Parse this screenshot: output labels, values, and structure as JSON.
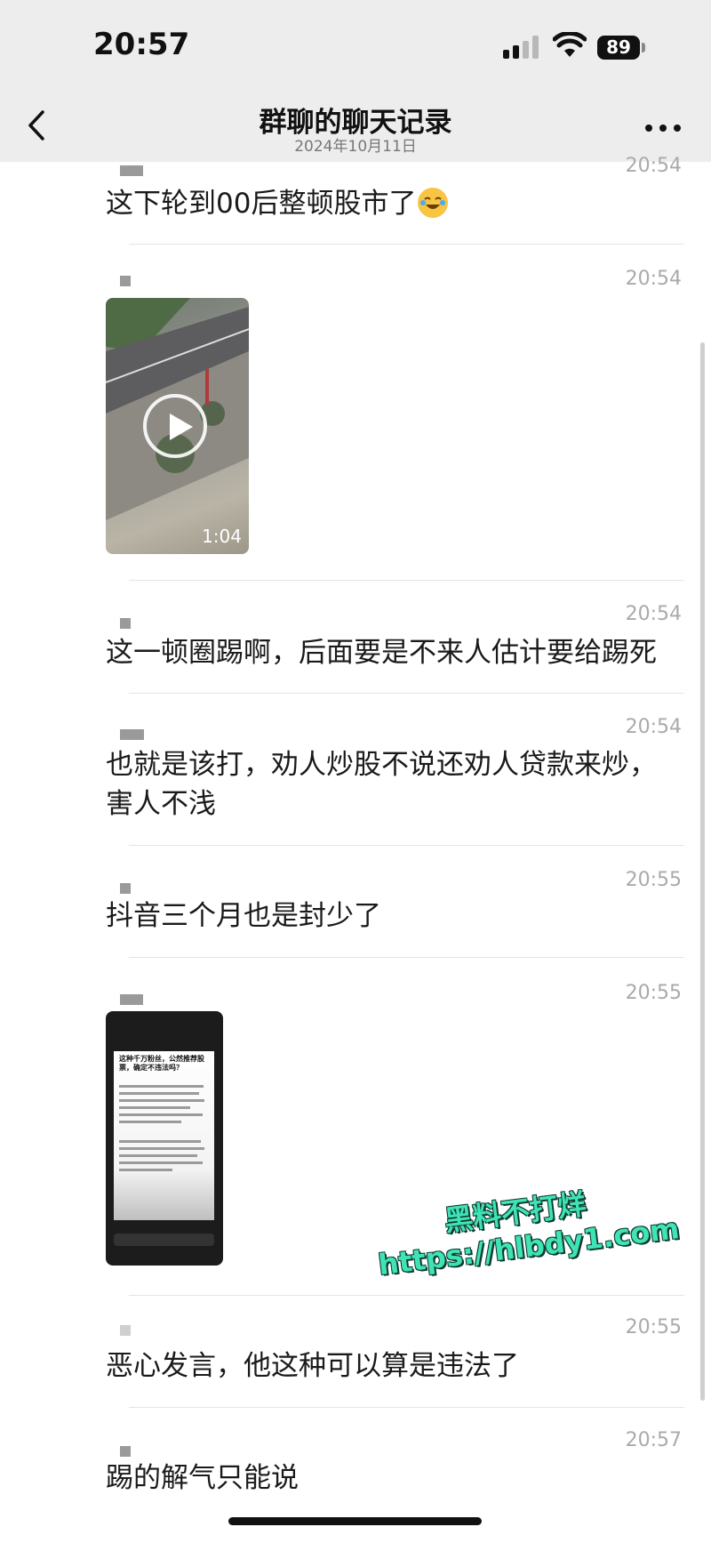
{
  "status_bar": {
    "time": "20:57",
    "battery": "89"
  },
  "nav": {
    "title": "群聊的聊天记录",
    "subtitle": "2024年10月11日"
  },
  "messages": [
    {
      "time": "20:54",
      "text": "这下轮到00后整顿股市了",
      "emoji": "laughing-crying-emoji"
    },
    {
      "time": "20:54",
      "video_duration": "1:04"
    },
    {
      "time": "20:54",
      "text": "这一顿圈踢啊，后面要是不来人估计要给踢死"
    },
    {
      "time": "20:54",
      "text": "也就是该打，劝人炒股不说还劝人贷款来炒，害人不浅"
    },
    {
      "time": "20:55",
      "text": "抖音三个月也是封少了"
    },
    {
      "time": "20:55",
      "screenshot_title": "这种千万粉丝，公然推荐股票，确定不违法吗？"
    },
    {
      "time": "20:55",
      "text": "恶心发言，他这种可以算是违法了"
    },
    {
      "time": "20:57",
      "text": "踢的解气只能说"
    }
  ],
  "watermark": {
    "line1": "黑料不打烊",
    "line2": "https://hlbdy1.com"
  },
  "colors": {
    "header_bg": "#ededed",
    "watermark": "#3fe3b6"
  }
}
